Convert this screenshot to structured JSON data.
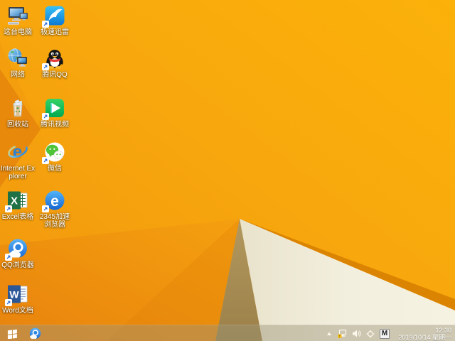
{
  "desktop": {
    "icons": [
      {
        "name": "this-pc-icon",
        "label": "这台电脑",
        "shortcut": false
      },
      {
        "name": "network-icon",
        "label": "网络",
        "shortcut": false
      },
      {
        "name": "recycle-bin-icon",
        "label": "回收站",
        "shortcut": false
      },
      {
        "name": "internet-explorer-icon",
        "label": "Internet Explorer",
        "shortcut": false
      },
      {
        "name": "excel-icon",
        "label": "Excel表格",
        "shortcut": true
      },
      {
        "name": "qq-browser-icon",
        "label": "QQ浏览器",
        "shortcut": true
      },
      {
        "name": "word-icon",
        "label": "Word文档",
        "shortcut": true
      },
      {
        "name": "xunlei-icon",
        "label": "极速迅雷",
        "shortcut": true
      },
      {
        "name": "tencent-qq-icon",
        "label": "腾讯QQ",
        "shortcut": true
      },
      {
        "name": "tencent-video-icon",
        "label": "腾讯视频",
        "shortcut": true
      },
      {
        "name": "wechat-icon",
        "label": "微信",
        "shortcut": true
      },
      {
        "name": "browser-2345-icon",
        "label": "2345加速浏览器",
        "shortcut": true
      }
    ]
  },
  "taskbar": {
    "start_button": "windows-start",
    "pinned": [
      "qq-browser"
    ],
    "tray_icons": [
      "hidden-icons-chevron",
      "network-status",
      "volume",
      "safety-center",
      "input-method"
    ],
    "ime_indicator": "M",
    "clock_time": "12:30",
    "clock_date": "2019/10/14 星期一"
  },
  "colors": {
    "wallpaper_bright_orange": "#FBB00A",
    "wallpaper_mid_orange": "#F49D10",
    "wallpaper_deep_orange": "#E8870E",
    "fold_strip_orange": "#DB8401",
    "fold_tan": "#A58B52",
    "fold_cream": "#F2EEDC",
    "taskbar_overlay": "rgba(158,148,122,0.45)",
    "label_text": "#FFFFFF"
  }
}
